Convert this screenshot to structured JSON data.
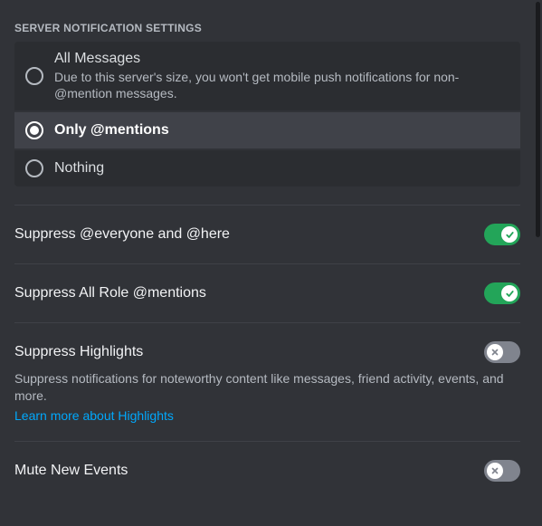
{
  "header": "Server Notification Settings",
  "radios": {
    "all": {
      "title": "All Messages",
      "desc": "Due to this server's size, you won't get mobile push notifications for non-@mention messages."
    },
    "mentions": {
      "title": "Only @mentions"
    },
    "nothing": {
      "title": "Nothing"
    }
  },
  "toggles": {
    "everyone": {
      "label": "Suppress @everyone and @here"
    },
    "roles": {
      "label": "Suppress All Role @mentions"
    },
    "highlights": {
      "label": "Suppress Highlights",
      "desc": "Suppress notifications for noteworthy content like messages, friend activity, events, and more.",
      "link": "Learn more about Highlights"
    },
    "events": {
      "label": "Mute New Events"
    }
  }
}
